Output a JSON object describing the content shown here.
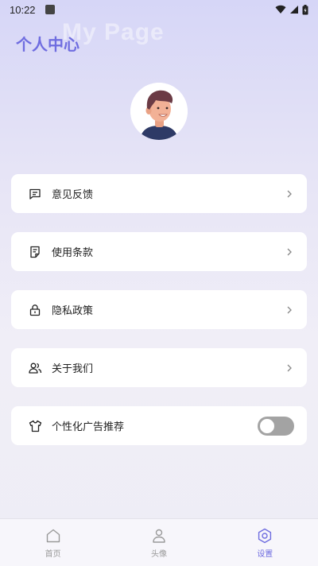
{
  "status_bar": {
    "time": "10:22"
  },
  "header": {
    "title": "个人中心",
    "watermark": "My Page"
  },
  "menu": [
    {
      "label": "意见反馈",
      "icon": "feedback-icon"
    },
    {
      "label": "使用条款",
      "icon": "document-icon"
    },
    {
      "label": "隐私政策",
      "icon": "lock-icon"
    },
    {
      "label": "关于我们",
      "icon": "users-icon"
    }
  ],
  "ad_setting": {
    "label": "个性化广告推荐",
    "icon": "tshirt-icon",
    "enabled": false
  },
  "bottom_nav": {
    "items": [
      {
        "label": "首页",
        "icon": "home-icon",
        "active": false
      },
      {
        "label": "头像",
        "icon": "person-icon",
        "active": false
      },
      {
        "label": "设置",
        "icon": "settings-icon",
        "active": true
      }
    ]
  },
  "colors": {
    "accent": "#6f6de0",
    "toggle_off": "#a3a3a3"
  }
}
